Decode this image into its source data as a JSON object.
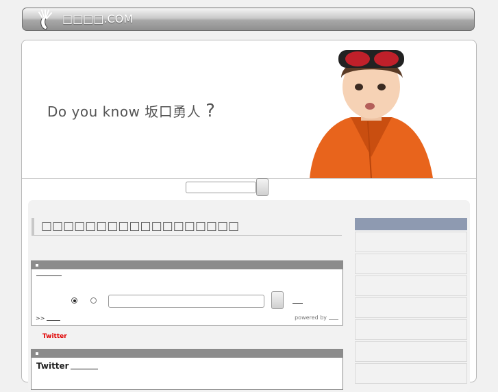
{
  "header": {
    "site_title": "□□□□.COM"
  },
  "banner": {
    "tagline_text": "Do you know 坂口勇人",
    "tagline_mark": "?"
  },
  "main": {
    "heading": "□□□□□□□□□□□□□□□□□□",
    "search_box": {
      "more_prefix": ">>",
      "powered_by": "powered by"
    },
    "twitter_label": "Twitter",
    "twitter_box": {
      "title": "Twitter"
    }
  },
  "colors": {
    "sidebar_header": "#8e9ab1",
    "box_bar": "#8c8c8c",
    "twitter_red": "#e00000"
  }
}
